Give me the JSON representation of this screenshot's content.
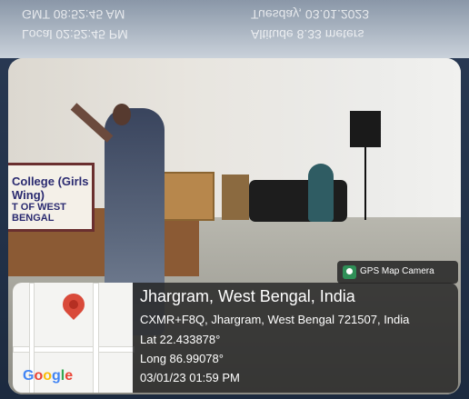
{
  "mirror_header": {
    "line1_left": "GMT 08:52:45 AM",
    "line2_left": "Local 02:52:45 PM",
    "line1_right": "Tuesday, 03.01.2023",
    "line2_right": "Altitude 8.33 meters"
  },
  "badge": {
    "label": "GPS Map Camera",
    "icon": "gps-map-camera-icon"
  },
  "location": {
    "title": "Jhargram, West Bengal, India",
    "address": "CXMR+F8Q, Jhargram, West Bengal 721507, India",
    "lat": "Lat 22.433878°",
    "long": "Long 86.99078°",
    "datetime": "03/01/23 01:59 PM"
  },
  "map": {
    "logo": "Google",
    "pin_color": "#d94a3a"
  },
  "scene_text": {
    "banner_line1": "College (Girls Wing)",
    "banner_line2": "T OF WEST BENGAL"
  }
}
